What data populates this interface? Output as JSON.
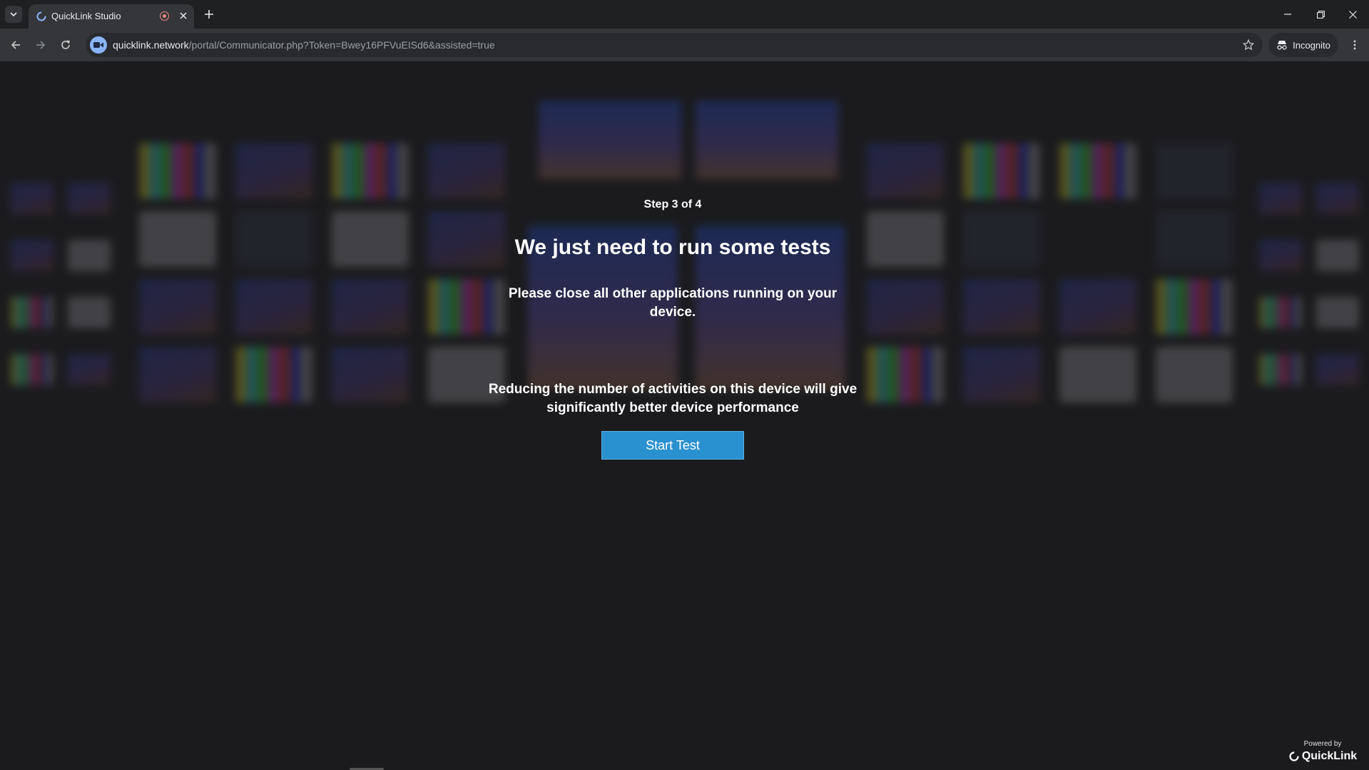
{
  "browser": {
    "tab": {
      "title": "QuickLink Studio"
    },
    "url": {
      "host": "quicklink.network",
      "path": "/portal/Communicator.php?Token=Bwey16PFVuEISd6&assisted=true"
    },
    "incognito_label": "Incognito"
  },
  "setup": {
    "step": "Step 3 of 4",
    "headline": "We just need to run some tests",
    "instruction": "Please close all other applications running on your device.",
    "performance_note": "Reducing the number of activities on this device will give significantly better device performance",
    "start_button": "Start Test"
  },
  "footer": {
    "powered_by": "Powered by",
    "brand": "QuickLink"
  },
  "colors": {
    "accent_button": "#2a91d0",
    "page_background": "#1b1b1e",
    "chrome_toolbar": "#35363a"
  },
  "icons": [
    "tab-search-icon",
    "quicklink-favicon-icon",
    "recording-icon",
    "close-icon",
    "plus-icon",
    "minimize-icon",
    "restore-icon",
    "back-arrow-icon",
    "forward-arrow-icon",
    "reload-icon",
    "video-site-icon",
    "star-icon",
    "incognito-icon",
    "more-vert-icon",
    "quicklink-logo-icon"
  ]
}
